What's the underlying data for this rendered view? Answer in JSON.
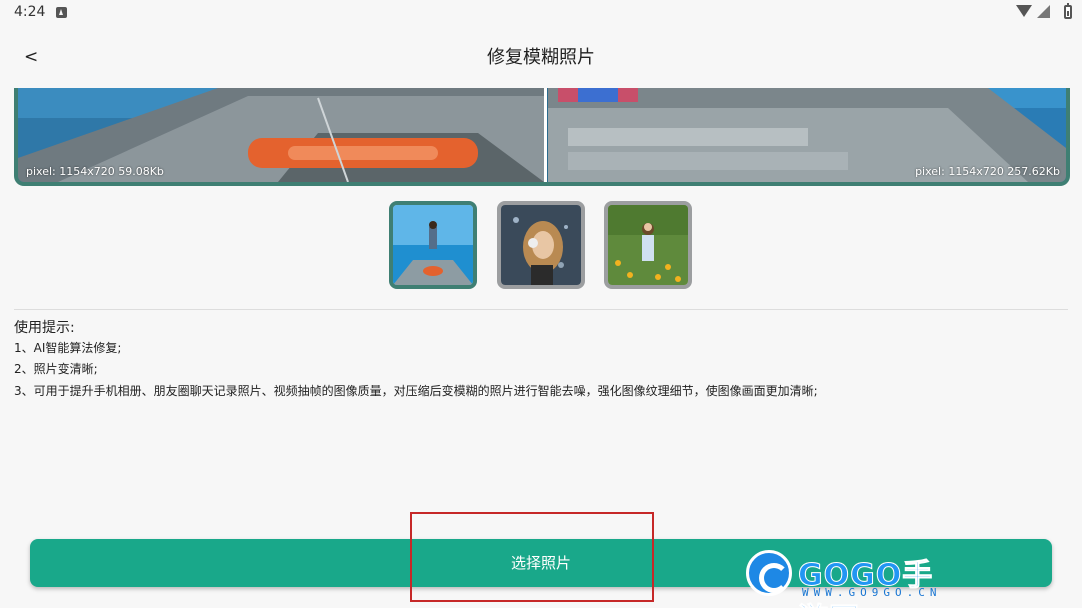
{
  "status_bar": {
    "time": "4:24"
  },
  "app_bar": {
    "back_label": "<",
    "title": "修复模糊照片"
  },
  "compare": {
    "left_info": "pixel: 1154x720 59.08Kb",
    "right_info": "pixel: 1154x720 257.62Kb"
  },
  "thumbnails": [
    {
      "name": "girl-on-boat",
      "selected": true
    },
    {
      "name": "girl-with-headphones",
      "selected": false
    },
    {
      "name": "girl-in-flower-field",
      "selected": false
    }
  ],
  "tips": {
    "title": "使用提示:",
    "items": [
      "1、AI智能算法修复;",
      "2、照片变清晰;",
      "3、可用于提升手机相册、朋友圈聊天记录照片、视频抽帧的图像质量，对压缩后变模糊的照片进行智能去噪，强化图像纹理细节，使图像画面更加清晰;"
    ]
  },
  "action": {
    "select_label": "选择照片"
  },
  "watermark": {
    "brand": "GOGO手游网",
    "url": "WWW.GO9GO.CN"
  },
  "colors": {
    "accent": "#19a88a",
    "frame": "#3f7f73",
    "highlight": "#c62828"
  }
}
